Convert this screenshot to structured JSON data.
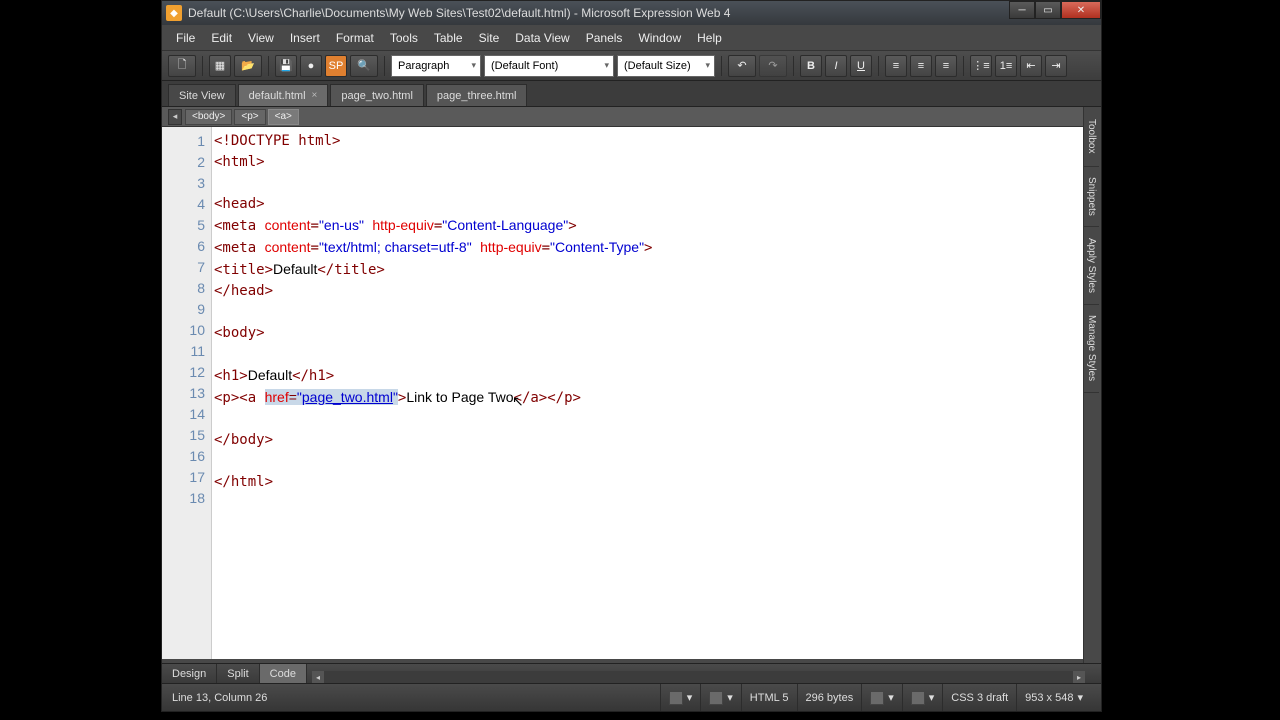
{
  "title": "Default (C:\\Users\\Charlie\\Documents\\My Web Sites\\Test02\\default.html) - Microsoft Expression Web 4",
  "menus": [
    "File",
    "Edit",
    "View",
    "Insert",
    "Format",
    "Tools",
    "Table",
    "Site",
    "Data View",
    "Panels",
    "Window",
    "Help"
  ],
  "toolbar": {
    "para": "Paragraph",
    "font": "(Default Font)",
    "size": "(Default Size)"
  },
  "tabs": {
    "site": "Site View",
    "items": [
      "default.html",
      "page_two.html",
      "page_three.html"
    ],
    "active": 0
  },
  "crumbs": [
    "<body>",
    "<p>",
    "<a>"
  ],
  "code": {
    "lines": [
      {
        "n": 1,
        "t": "<!DOCTYPE html>"
      },
      {
        "n": 2,
        "t": "<html>"
      },
      {
        "n": 3,
        "t": ""
      },
      {
        "n": 4,
        "t": "<head>"
      },
      {
        "n": 5,
        "t": "line5"
      },
      {
        "n": 6,
        "t": "line6"
      },
      {
        "n": 7,
        "t": "line7"
      },
      {
        "n": 8,
        "t": "</head>"
      },
      {
        "n": 9,
        "t": ""
      },
      {
        "n": 10,
        "t": "<body>"
      },
      {
        "n": 11,
        "t": ""
      },
      {
        "n": 12,
        "t": "line12"
      },
      {
        "n": 13,
        "t": "line13"
      },
      {
        "n": 14,
        "t": ""
      },
      {
        "n": 15,
        "t": "</body>"
      },
      {
        "n": 16,
        "t": ""
      },
      {
        "n": 17,
        "t": "</html>"
      },
      {
        "n": 18,
        "t": ""
      }
    ],
    "l5_attr1": "content",
    "l5_str1": "\"en-us\"",
    "l5_attr2": "http-equiv",
    "l5_str2": "\"Content-Language\"",
    "l6_attr1": "content",
    "l6_str1": "\"text/html; charset=utf-8\"",
    "l6_attr2": "http-equiv",
    "l6_str2": "\"Content-Type\"",
    "l7_txt": "Default",
    "l12_txt": "Default",
    "l13_attr": "href",
    "l13_q1": "\"",
    "l13_link": "page_two.html",
    "l13_q2": "\"",
    "l13_txt": "Link to Page Two"
  },
  "views": [
    "Design",
    "Split",
    "Code"
  ],
  "sidetabs": [
    "Toolbox",
    "Snippets",
    "Apply Styles",
    "Manage Styles"
  ],
  "status": {
    "pos": "Line 13, Column 26",
    "doctype": "HTML 5",
    "size": "296 bytes",
    "css": "CSS 3 draft",
    "dims": "953 x 548"
  }
}
